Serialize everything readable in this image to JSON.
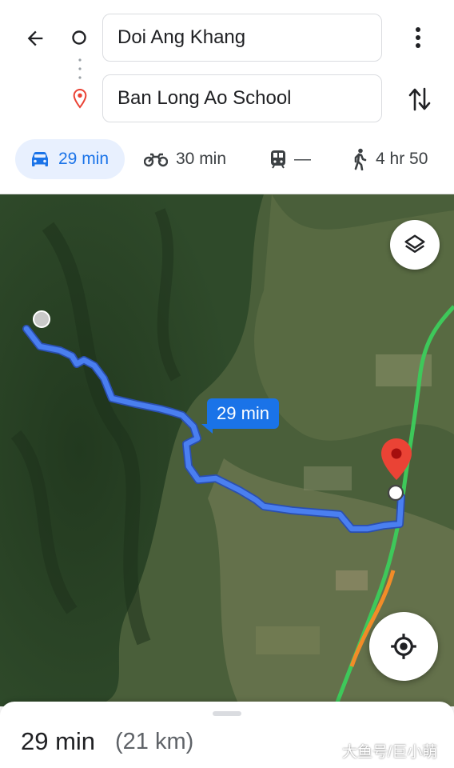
{
  "header": {
    "origin_value": "Doi Ang Khang",
    "destination_value": "Ban Long Ao School"
  },
  "modes": [
    {
      "name": "driving",
      "label": "29 min",
      "icon": "car-icon",
      "active": true
    },
    {
      "name": "motorcycle",
      "label": "30 min",
      "icon": "motorcycle-icon",
      "active": false
    },
    {
      "name": "transit",
      "label": "—",
      "icon": "train-icon",
      "active": false
    },
    {
      "name": "walking",
      "label": "4 hr 50",
      "icon": "walking-icon",
      "active": false
    }
  ],
  "map": {
    "route_label": "29 min",
    "route_color": "#4a7ff0",
    "traffic_color": "#3ec85a",
    "slow_color": "#f28c28"
  },
  "summary": {
    "time": "29 min",
    "distance": "(21 km)"
  },
  "watermark": "大鱼号/巨小萌",
  "colors": {
    "accent": "#1a73e8",
    "active_bg": "#e8f0fe",
    "pin_red": "#ea4335"
  }
}
